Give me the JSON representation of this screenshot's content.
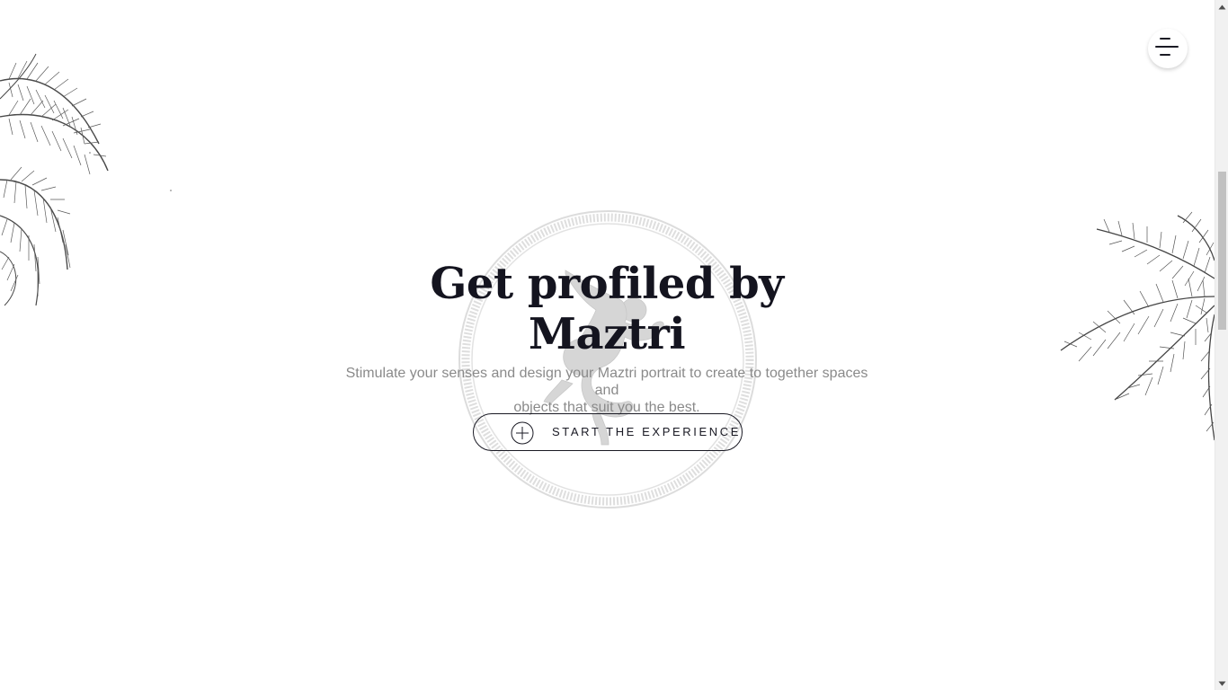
{
  "hero": {
    "title_line1": "Get profiled by",
    "title_line2": "Maztri",
    "subtitle_line1": "Stimulate your senses and design your Maztri portrait to create to together spaces and",
    "subtitle_line2": "objects that suit you the best.",
    "cta_label": "START THE EXPERIENCE",
    "cta_icon": "plus-circle-icon"
  },
  "header": {
    "menu_icon": "hamburger-menu-icon"
  },
  "decor": {
    "left_illustration": "palm-leaves-illustration",
    "right_illustration": "palm-leaves-illustration",
    "center_illustration": "dancer-medallion-illustration"
  },
  "colors": {
    "background": "#ffffff",
    "title": "#14141f",
    "subtitle": "#8a8a8a",
    "button_border": "#1a1a24",
    "illustration": "#555555"
  }
}
